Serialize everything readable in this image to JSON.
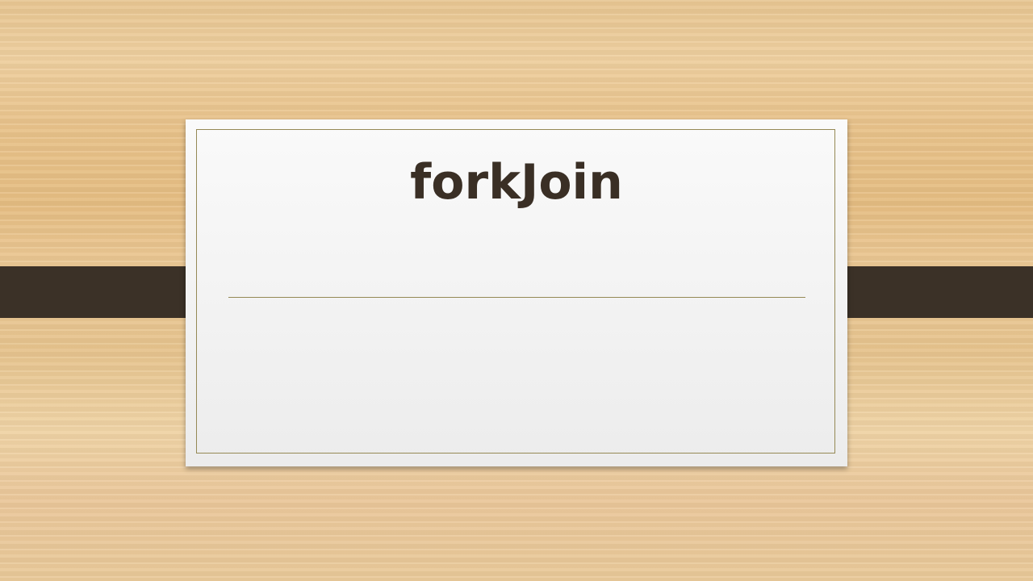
{
  "slide": {
    "title": "forkJoin"
  },
  "colors": {
    "band": "#3b3127",
    "frame": "#958955",
    "title_text": "#3a2f25",
    "card": "#f5f5f5",
    "background": "#e9c591"
  }
}
